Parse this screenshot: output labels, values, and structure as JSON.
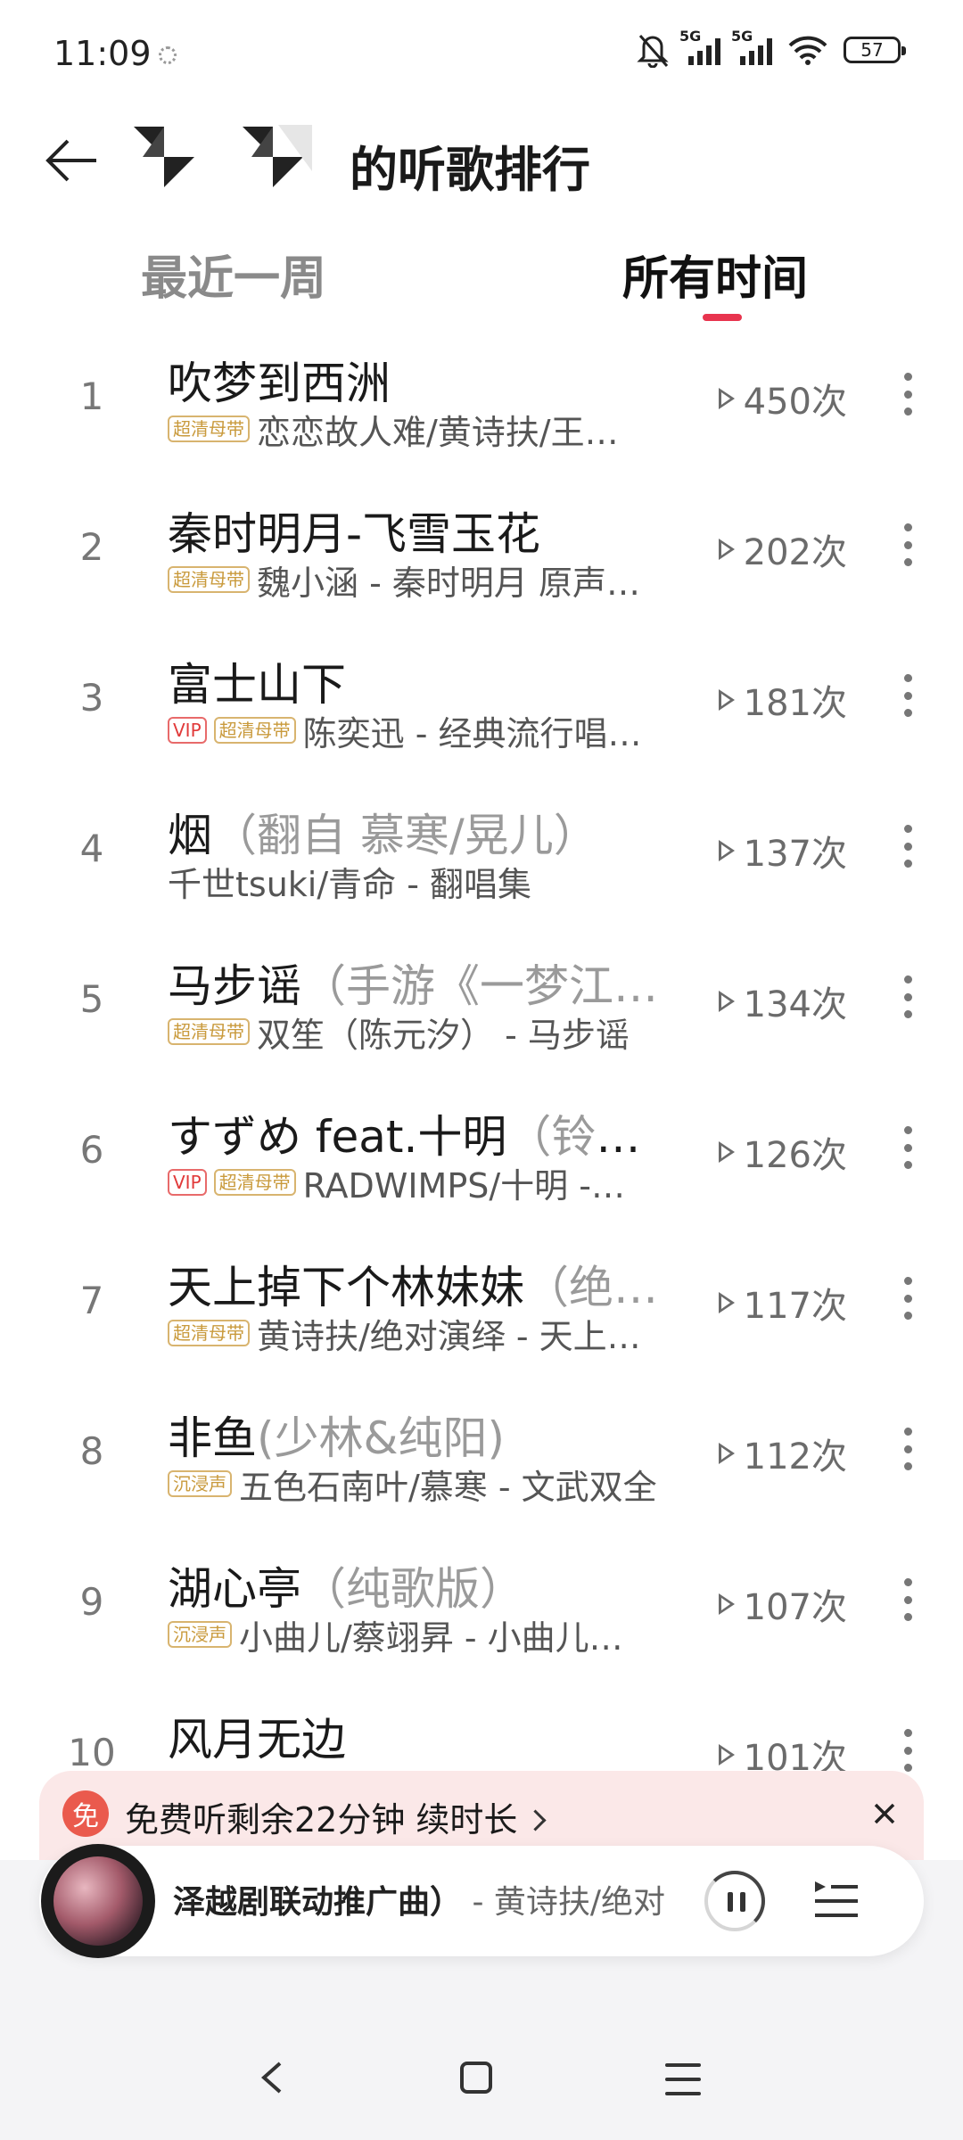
{
  "status_bar": {
    "time": "11:09",
    "network_1": "5G",
    "network_2": "5G",
    "battery": "57"
  },
  "header": {
    "title": "的听歌排行"
  },
  "tabs": [
    {
      "label": "最近一周",
      "active": false
    },
    {
      "label": "所有时间",
      "active": true
    }
  ],
  "rows": [
    {
      "rank": "1",
      "title": "吹梦到西洲",
      "subtitle": "",
      "tags": [
        "超清母带"
      ],
      "artist": "恋恋故人难/黄诗扶/王…",
      "plays": "450次"
    },
    {
      "rank": "2",
      "title": "秦时明月-飞雪玉花",
      "subtitle": "",
      "tags": [
        "超清母带"
      ],
      "artist": "魏小涵 - 秦时明月 原声…",
      "plays": "202次"
    },
    {
      "rank": "3",
      "title": "富士山下",
      "subtitle": "",
      "tags": [
        "VIP",
        "超清母带"
      ],
      "artist": "陈奕迅 - 经典流行唱…",
      "plays": "181次"
    },
    {
      "rank": "4",
      "title": "烟",
      "subtitle": "（翻自 慕寒/晃儿）",
      "tags": [],
      "artist": "千世tsuki/青命 - 翻唱集",
      "plays": "137次"
    },
    {
      "rank": "5",
      "title": "马步谣",
      "subtitle": "（手游《一梦江…",
      "tags": [
        "超清母带"
      ],
      "artist": "双笙（陈元汐） - 马步谣",
      "plays": "134次"
    },
    {
      "rank": "6",
      "title": "すずめ feat.十明",
      "subtitle": "（铃芽）",
      "tags": [
        "VIP",
        "超清母带"
      ],
      "artist": "RADWIMPS/十明 -…",
      "plays": "126次"
    },
    {
      "rank": "7",
      "title": "天上掉下个林妹妹",
      "subtitle": "（绝…",
      "tags": [
        "超清母带"
      ],
      "artist": "黄诗扶/绝对演绎 - 天上…",
      "plays": "117次"
    },
    {
      "rank": "8",
      "title": "非鱼",
      "subtitle": "(少林&纯阳)",
      "tags": [
        "沉浸声"
      ],
      "artist": "五色石南叶/慕寒 - 文武双全",
      "plays": "112次"
    },
    {
      "rank": "9",
      "title": "湖心亭",
      "subtitle": "（纯歌版）",
      "tags": [
        "沉浸声"
      ],
      "artist": "小曲儿/蔡翊昇 - 小曲儿…",
      "plays": "107次"
    },
    {
      "rank": "10",
      "title": "风月无边",
      "subtitle": "",
      "tags": [],
      "artist": "",
      "plays": "101次"
    }
  ],
  "banner": {
    "badge": "免",
    "text": "免费听剩余22分钟 续时长"
  },
  "player": {
    "now_title": "泽越剧联动推广曲）",
    "now_artist": " - 黄诗扶/绝对"
  },
  "colors": {
    "accent": "#e8344e",
    "vip": "#e13a3a",
    "hq_tag": "#c99a3c",
    "free_badge": "#ea5a4d"
  }
}
